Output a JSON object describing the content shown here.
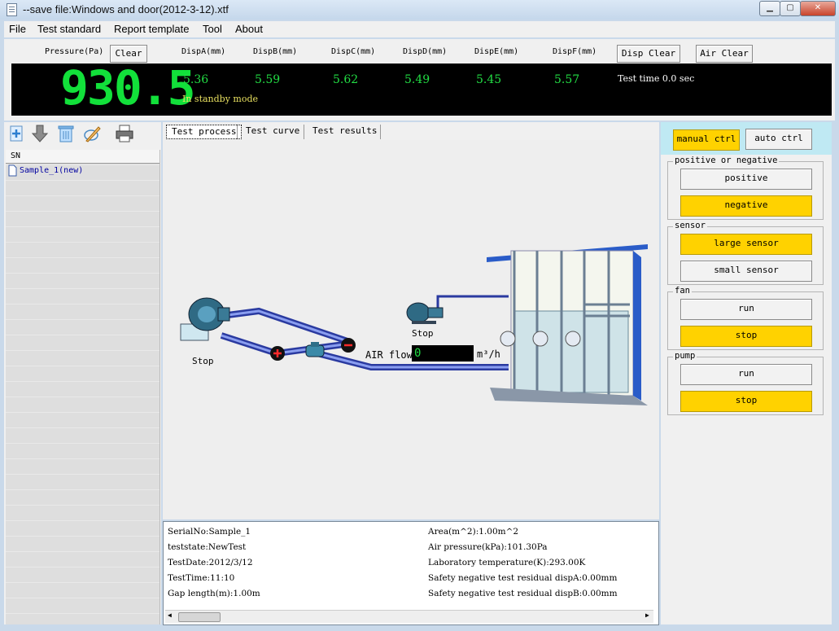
{
  "window": {
    "title": "--save file:Windows and door(2012-3-12).xtf"
  },
  "menu": [
    "File",
    "Test standard",
    "Report template",
    "Tool",
    "About"
  ],
  "measure": {
    "pressure_label": "Pressure(Pa)",
    "clear_label": "Clear",
    "disp_headers": [
      "DispA(mm)",
      "DispB(mm)",
      "DispC(mm)",
      "DispD(mm)",
      "DispE(mm)",
      "DispF(mm)"
    ],
    "disp_clear_label": "Disp Clear",
    "air_clear_label": "Air Clear",
    "pressure_value": "930.5",
    "disp_values": [
      "5.36",
      "5.59",
      "5.62",
      "5.49",
      "5.45",
      "5.57"
    ],
    "status": "In standby mode",
    "test_time": "Test time 0.0 sec"
  },
  "samples": {
    "header": "SN",
    "items": [
      "Sample_1(new)"
    ]
  },
  "tabs": [
    "Test process",
    "Test curve",
    "Test results"
  ],
  "process": {
    "fan_status": "Stop",
    "pump_status": "Stop",
    "air_flow_label": "AIR flow",
    "air_flow_value": "0",
    "air_flow_unit": "m³/h"
  },
  "info": {
    "left": [
      "SerialNo:Sample_1",
      "teststate:NewTest",
      "TestDate:2012/3/12",
      "TestTime:11:10",
      "Gap length(m):1.00m"
    ],
    "right": [
      "Area(m^2):1.00m^2",
      "Air pressure(kPa):101.30Pa",
      "Laboratory temperature(K):293.00K",
      "Safety negative test residual dispA:0.00mm",
      "Safety negative test residual dispB:0.00mm"
    ]
  },
  "control": {
    "manual_label": "manual ctrl",
    "auto_label": "auto ctrl",
    "groups": [
      {
        "title": "positive or negative",
        "buttons": [
          "positive",
          "negative"
        ],
        "active": 1
      },
      {
        "title": "sensor",
        "buttons": [
          "large sensor",
          "small sensor"
        ],
        "active": 0
      },
      {
        "title": "fan",
        "buttons": [
          "run",
          "stop"
        ],
        "active": 1
      },
      {
        "title": "pump",
        "buttons": [
          "run",
          "stop"
        ],
        "active": 1
      }
    ]
  },
  "colors": {
    "display_green": "#12e03a",
    "active_yellow": "#ffd200",
    "standby_yellow": "#e8e060"
  }
}
